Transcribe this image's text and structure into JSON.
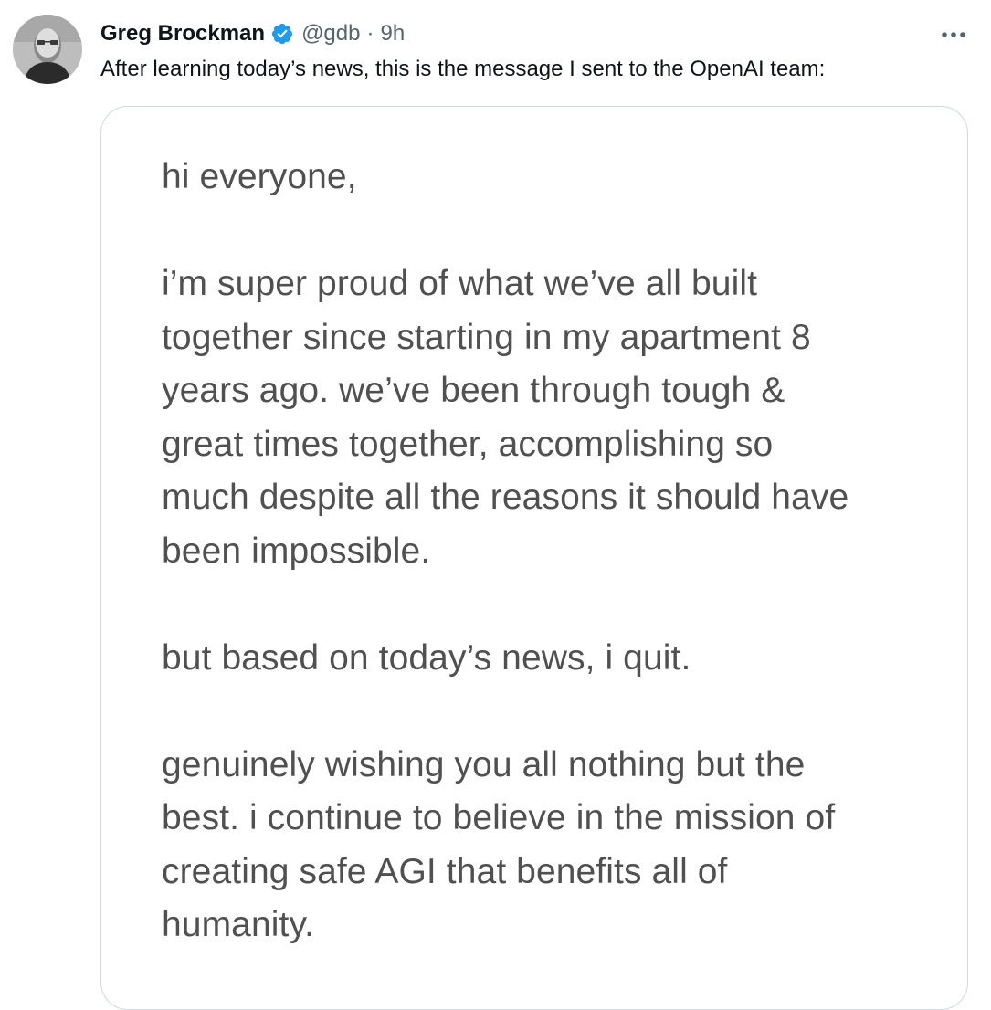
{
  "tweet": {
    "author": {
      "name": "Greg Brockman",
      "handle": "@gdb",
      "verified": true,
      "avatar": "avatar-photo"
    },
    "separator": "·",
    "timestamp": "9h",
    "text": "After learning today’s news, this is the message I sent to the OpenAI team:",
    "more_icon": "more-horizontal-icon",
    "verified_icon": "verified-badge-icon"
  },
  "media": {
    "lines": [
      "hi everyone,",
      "",
      "i’m super proud of what we’ve all built",
      "together since starting in my apartment 8",
      "years ago. we’ve been through tough &",
      "great times together, accomplishing so",
      "much despite all the reasons it should have",
      "been impossible.",
      "",
      "but based on today’s news, i quit.",
      "",
      "genuinely wishing you all nothing but the",
      "best. i continue to believe in the mission of",
      "creating safe AGI that benefits all of",
      "humanity."
    ]
  },
  "colors": {
    "verified_blue": "#1d9bf0",
    "secondary_text": "#536471",
    "card_border": "#cfd9de",
    "note_text": "#505050"
  }
}
